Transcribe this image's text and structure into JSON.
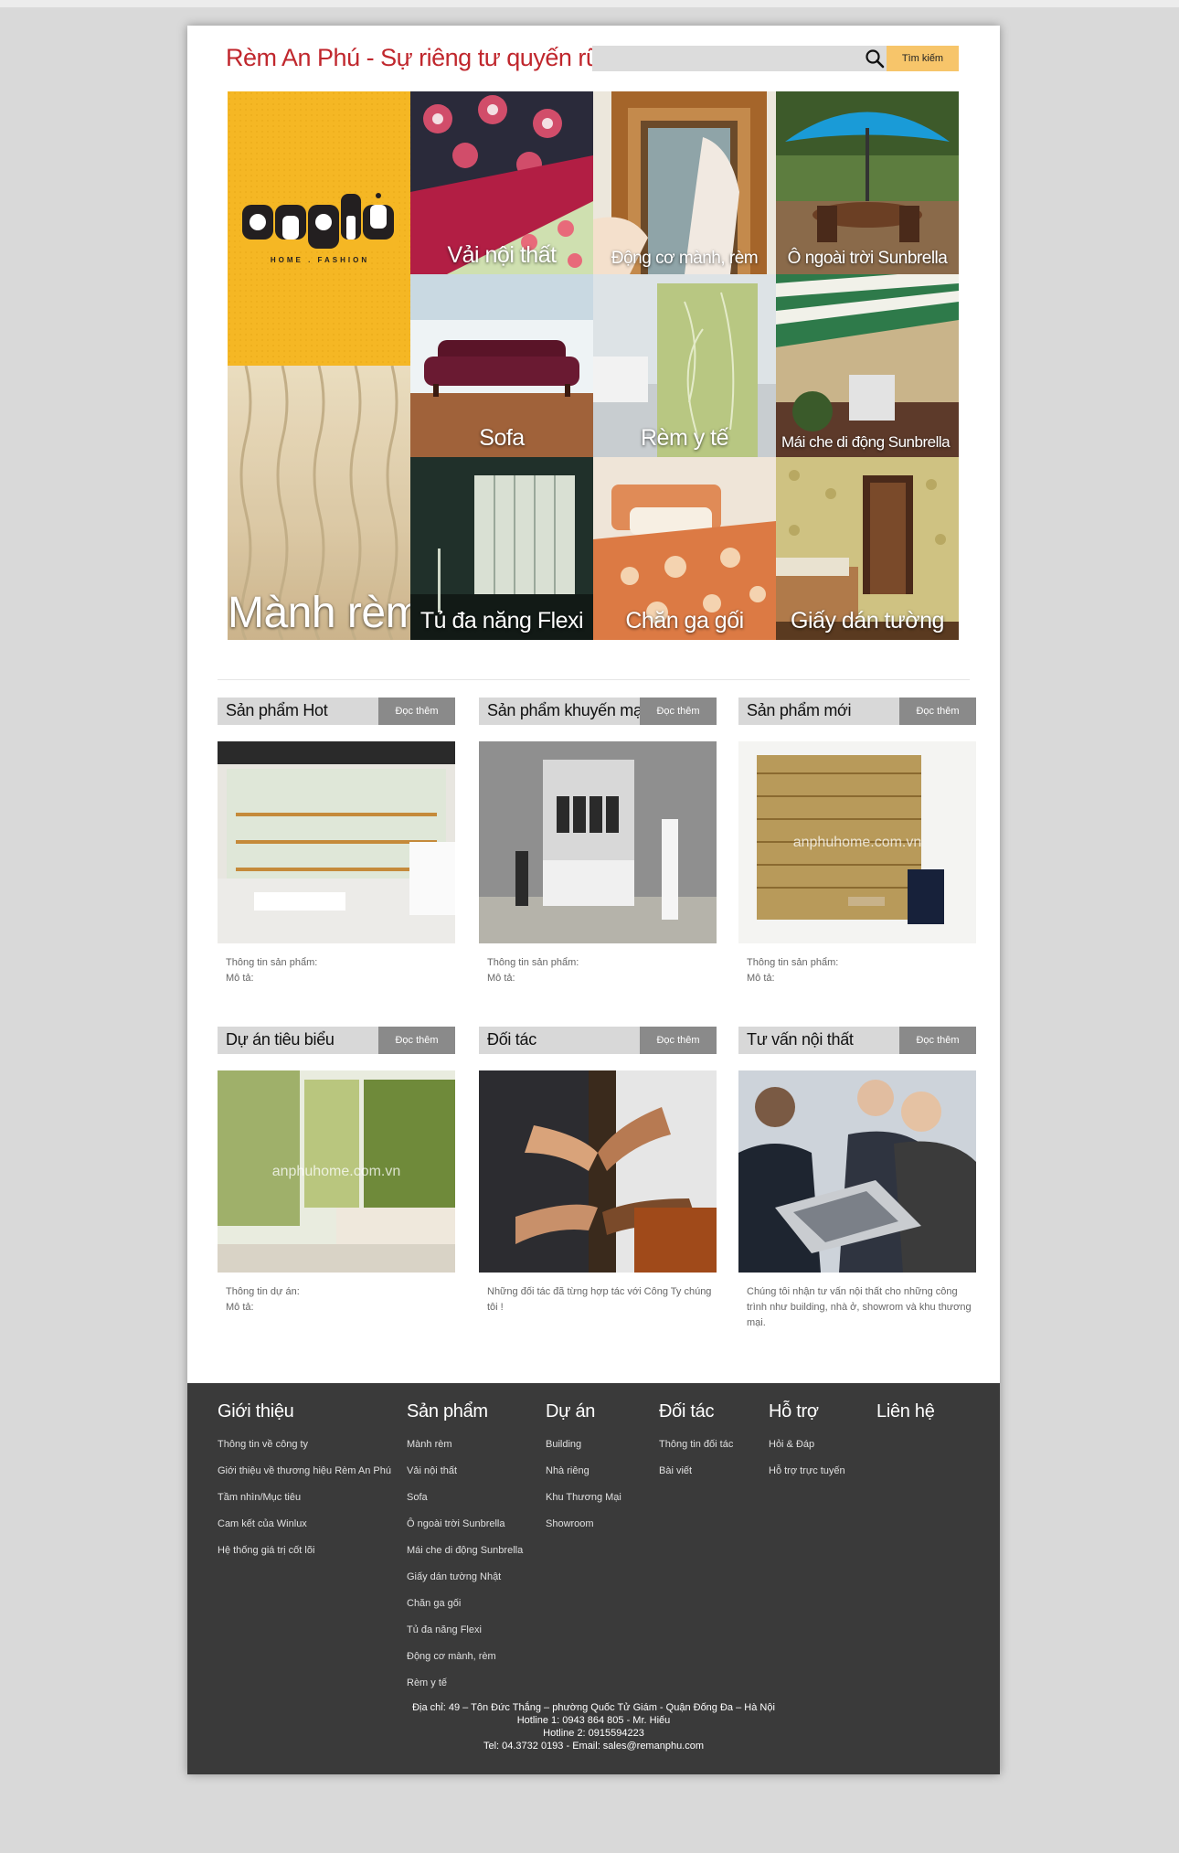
{
  "header": {
    "title": "Rèm An Phú - Sự riêng tư quyến rũ!",
    "search_placeholder": "",
    "search_button": "Tìm kiếm"
  },
  "brand": {
    "logo_text": "anphu",
    "logo_sub": "HOME . FASHION",
    "colors": {
      "title": "#c0272d",
      "search_button": "#f7c56a",
      "footer_bg": "#3a3a3a",
      "button_grey": "#8a8a8a",
      "logo_tile": "#f5b724"
    }
  },
  "mosaic": [
    {
      "label": "Vải nội thất"
    },
    {
      "label": "Động cơ mành, rèm"
    },
    {
      "label": "Ô ngoài trời Sunbrella"
    },
    {
      "label": "Sofa"
    },
    {
      "label": "Rèm y tế"
    },
    {
      "label": "Mái che di động Sunbrella"
    },
    {
      "label": "Mành rèm"
    },
    {
      "label": "Tủ đa năng Flexi"
    },
    {
      "label": "Chăn ga gối"
    },
    {
      "label": "Giấy dán tường"
    }
  ],
  "sections": [
    {
      "title": "Sản phẩm Hot",
      "button": "Đọc thêm",
      "lines": [
        "Thông tin sản phẩm:",
        "Mô tả:"
      ]
    },
    {
      "title": "Sản phẩm khuyến mại",
      "button": "Đọc thêm",
      "lines": [
        "Thông tin sản phẩm:",
        "Mô tả:"
      ]
    },
    {
      "title": "Sản phẩm mới",
      "button": "Đọc thêm",
      "lines": [
        "Thông tin sản phẩm:",
        "Mô tả:"
      ],
      "watermark": "anphuhome.com.vn"
    },
    {
      "title": "Dự án tiêu biểu",
      "button": "Đọc thêm",
      "lines": [
        "Thông tin dự án:",
        "Mô tả:"
      ],
      "watermark": "anphuhome.com.vn"
    },
    {
      "title": "Đối tác",
      "button": "Đọc thêm",
      "lines": [
        "Những đối tác đã từng hợp tác với Công Ty chúng tôi !"
      ]
    },
    {
      "title": "Tư vấn nội thất",
      "button": "Đọc thêm",
      "lines": [
        "Chúng tôi nhận tư vấn nội thất cho những công trình như building, nhà ở, showrom và khu thương mại."
      ]
    }
  ],
  "footer": {
    "columns": [
      {
        "title": "Giới thiệu",
        "links": [
          "Thông tin về công ty",
          "Giới thiệu về thương hiệu Rèm An Phú",
          "Tầm nhìn/Mục tiêu",
          "Cam kết của Winlux",
          "Hệ thống giá trị cốt lõi"
        ]
      },
      {
        "title": "Sản phẩm",
        "links": [
          "Mành rèm",
          "Vải nội thất",
          "Sofa",
          "Ô ngoài trời Sunbrella",
          "Mái che di động Sunbrella",
          "Giấy dán tường Nhật",
          "Chăn ga gối",
          "Tủ đa năng Flexi",
          "Động cơ mành, rèm",
          "Rèm y tế"
        ]
      },
      {
        "title": "Dự án",
        "links": [
          "Building",
          "Nhà riêng",
          "Khu Thương Mại",
          "Showroom"
        ]
      },
      {
        "title": "Đối tác",
        "links": [
          "Thông tin đối tác",
          "Bài viết"
        ]
      },
      {
        "title": "Hỗ trợ",
        "links": [
          "Hỏi & Đáp",
          "Hỗ trợ trực tuyến"
        ]
      },
      {
        "title": "Liên hệ",
        "links": []
      }
    ],
    "address": [
      "Địa chỉ: 49 – Tôn Đức Thắng – phường Quốc Tử Giám - Quận Đống Đa – Hà Nội",
      "Hotline 1: 0943 864 805 - Mr. Hiếu",
      "Hotline 2: 0915594223",
      "Tel: 04.3732 0193 - Email: sales@remanphu.com"
    ]
  }
}
